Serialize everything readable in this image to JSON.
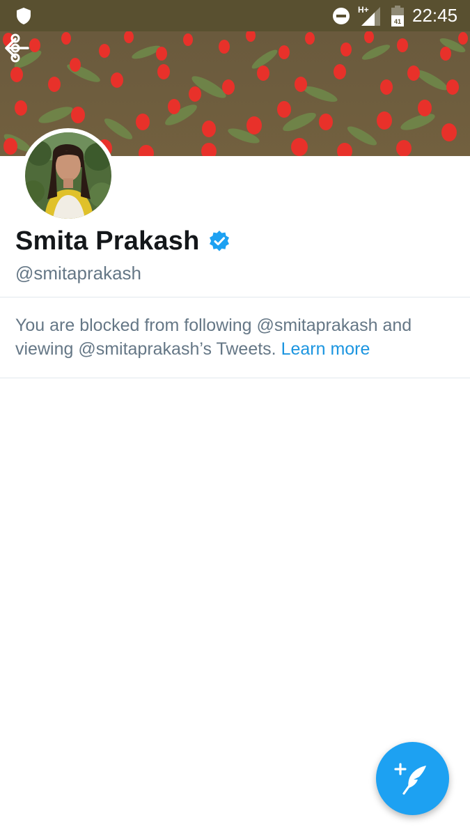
{
  "status_bar": {
    "time": "22:45",
    "network_label": "H+",
    "battery_level": "41",
    "icons": [
      "shield-icon",
      "do-not-disturb-icon",
      "signal-icon",
      "battery-icon"
    ]
  },
  "header": {
    "back_icon": "arrow-left-icon",
    "more_icon": "more-vertical-icon"
  },
  "profile": {
    "display_name": "Smita Prakash",
    "handle": "@smitaprakash",
    "verified": true
  },
  "blocked": {
    "message": "You are blocked from following @smitaprakash and viewing @smitaprakash’s Tweets.",
    "link_label": "Learn more"
  },
  "fab": {
    "icon": "compose-tweet-icon"
  },
  "colors": {
    "status_bar_bg": "#595030",
    "accent": "#1da1f2",
    "link": "#1b95e0",
    "text_primary": "#14171a",
    "text_secondary": "#657786"
  }
}
